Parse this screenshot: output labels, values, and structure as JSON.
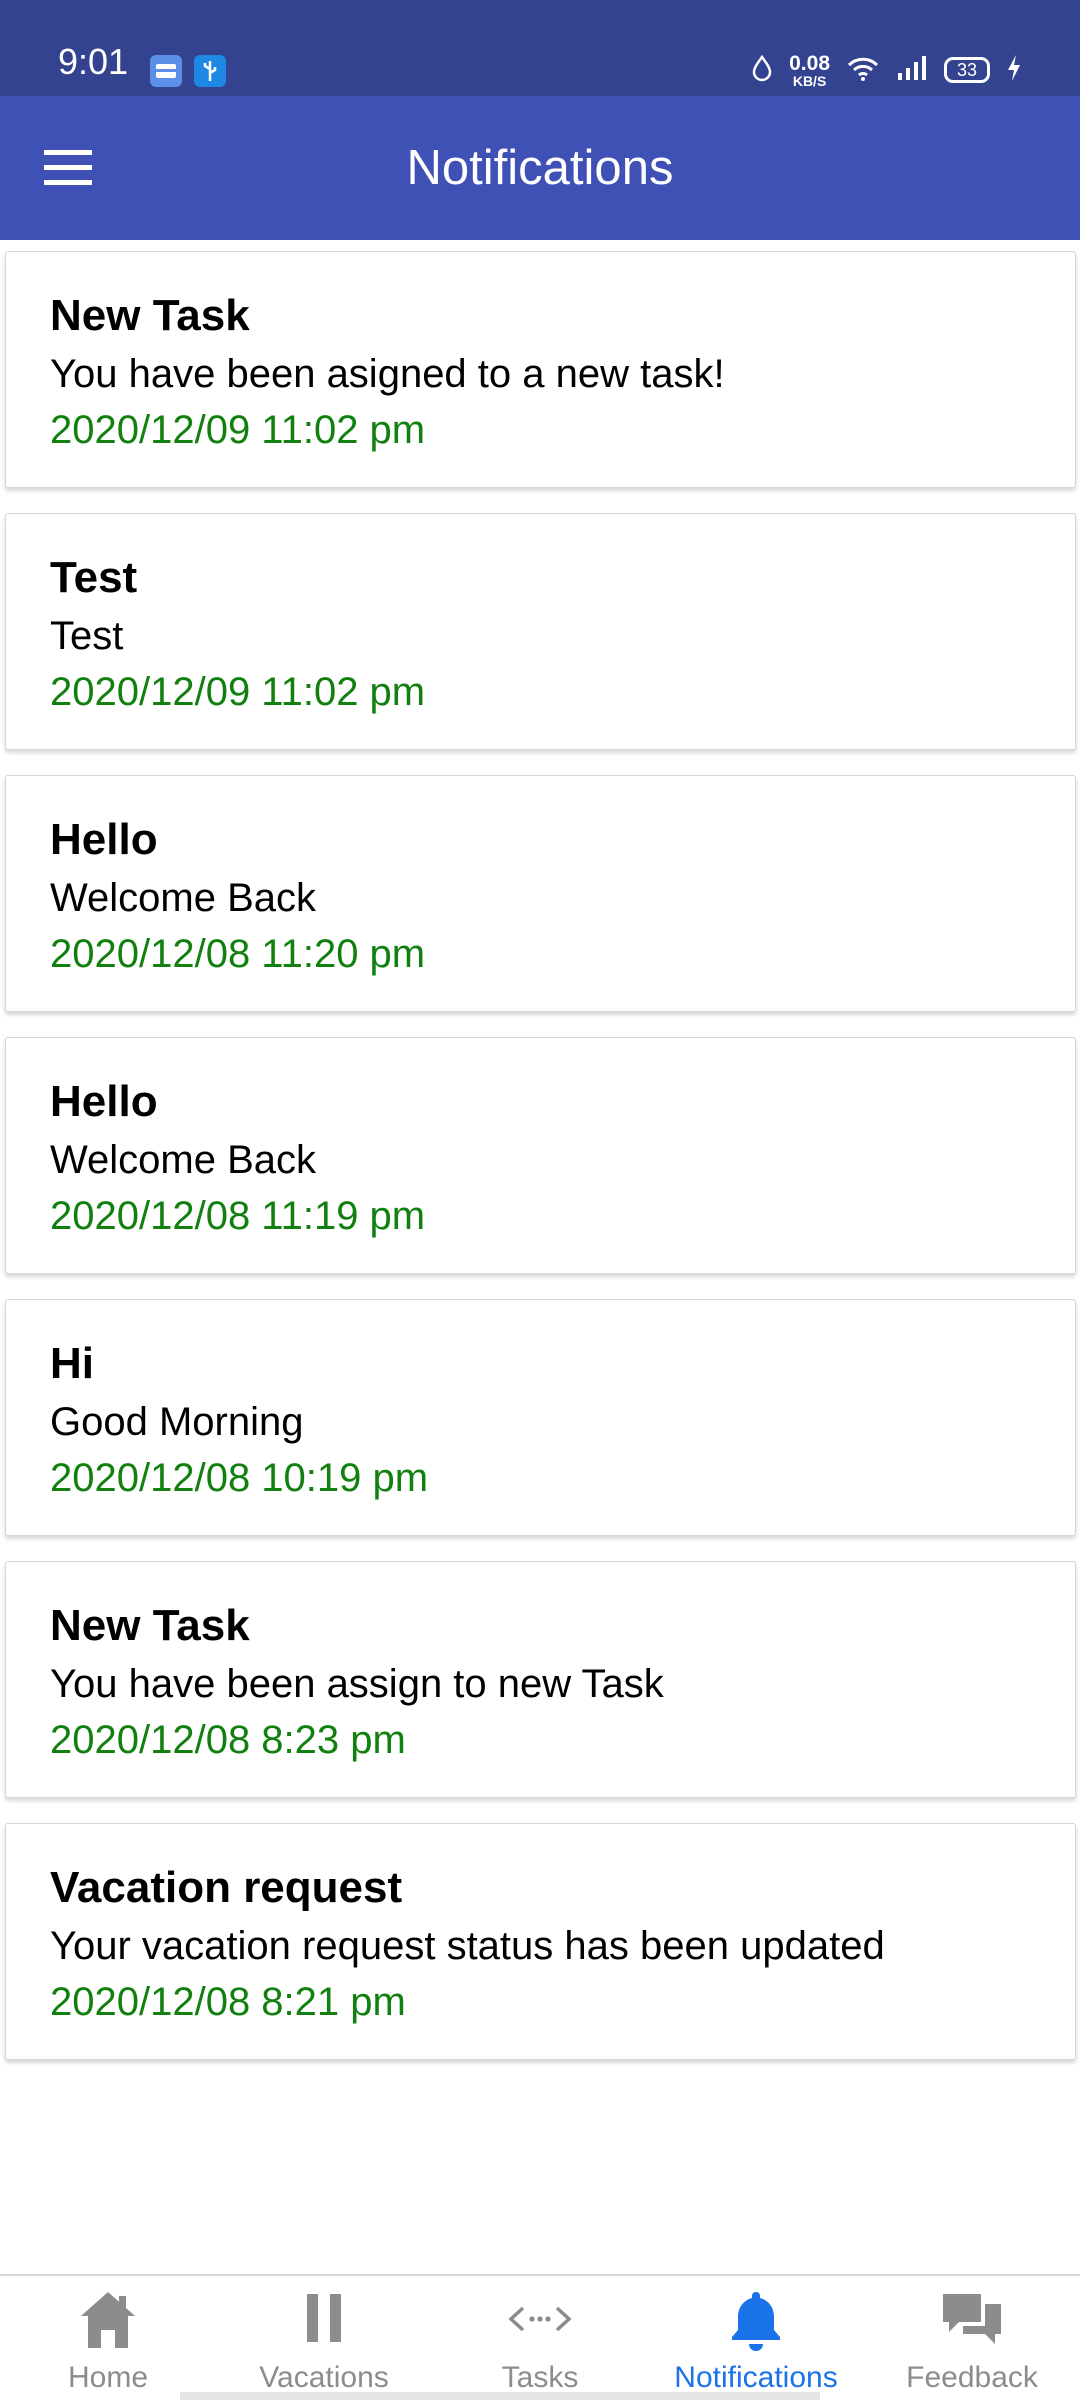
{
  "status_bar": {
    "time": "9:01",
    "net_speed_value": "0.08",
    "net_speed_unit": "KB/S",
    "battery_level": "33"
  },
  "app_bar": {
    "title": "Notifications"
  },
  "notifications": [
    {
      "title": "New Task",
      "body": "You have been asigned to a new task!",
      "time": "2020/12/09 11:02 pm"
    },
    {
      "title": "Test",
      "body": "Test",
      "time": "2020/12/09 11:02 pm"
    },
    {
      "title": "Hello",
      "body": "Welcome Back",
      "time": "2020/12/08 11:20 pm"
    },
    {
      "title": "Hello",
      "body": "Welcome Back",
      "time": "2020/12/08 11:19 pm"
    },
    {
      "title": "Hi",
      "body": "Good Morning",
      "time": "2020/12/08 10:19 pm"
    },
    {
      "title": "New Task",
      "body": "You have been assign to new Task",
      "time": "2020/12/08 8:23 pm"
    },
    {
      "title": "Vacation request",
      "body": "Your vacation request status has been updated",
      "time": "2020/12/08 8:21 pm"
    }
  ],
  "bottom_nav": {
    "items": [
      {
        "label": "Home",
        "icon": "home-icon"
      },
      {
        "label": "Vacations",
        "icon": "pause-icon"
      },
      {
        "label": "Tasks",
        "icon": "code-arrows-icon"
      },
      {
        "label": "Notifications",
        "icon": "bell-icon"
      },
      {
        "label": "Feedback",
        "icon": "chat-bubbles-icon"
      }
    ],
    "active_index": 3
  },
  "colors": {
    "status_bar": "#34438f",
    "app_bar": "#3f51b5",
    "timestamp": "#11800f",
    "nav_active": "#1a73e8",
    "nav_inactive": "#8c8c8c"
  }
}
